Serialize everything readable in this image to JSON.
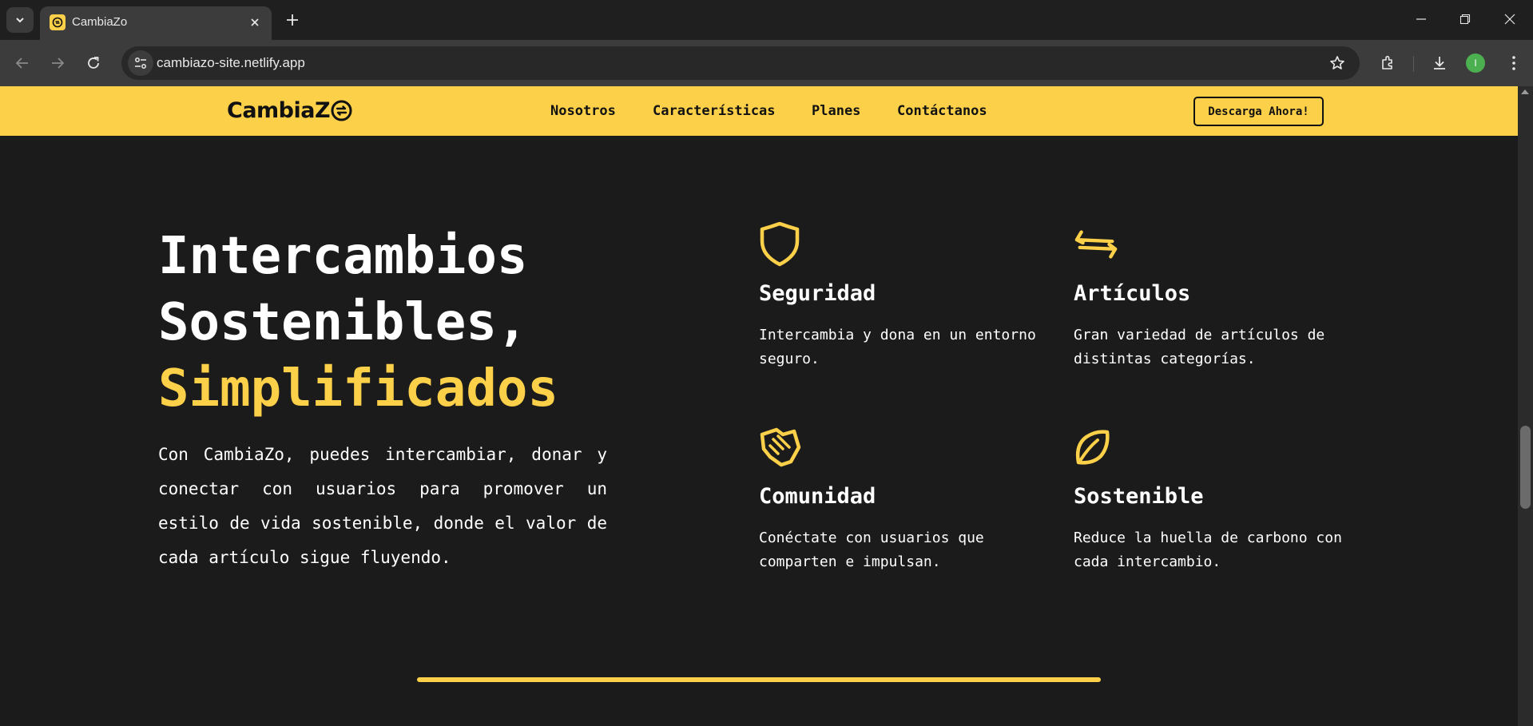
{
  "browser": {
    "tab_title": "CambiaZo",
    "url": "cambiazo-site.netlify.app",
    "profile_initial": "I",
    "icons": [
      "tab-search-icon",
      "close-icon",
      "plus-icon",
      "minimize-icon",
      "restore-icon",
      "close-window-icon",
      "back-icon",
      "forward-icon",
      "reload-icon",
      "site-info-icon",
      "star-icon",
      "extensions-icon",
      "download-icon",
      "menu-icon"
    ]
  },
  "site": {
    "logo_text": "CambiaZ",
    "nav": {
      "links": [
        "Nosotros",
        "Características",
        "Planes",
        "Contáctanos"
      ],
      "cta": "Descarga Ahora!"
    },
    "hero": {
      "title_line1": "Intercambios",
      "title_line2": "Sostenibles,",
      "title_accent": "Simplificados",
      "description": "Con CambiaZo, puedes intercambiar, donar y conectar con usuarios para promover un estilo de vida sostenible, donde el valor de cada artículo sigue fluyendo."
    },
    "features": [
      {
        "icon": "shield-icon",
        "title": "Seguridad",
        "text": "Intercambia y dona en un entorno seguro."
      },
      {
        "icon": "arrows-exchange-icon",
        "title": "Artículos",
        "text": "Gran variedad de artículos de distintas categorías."
      },
      {
        "icon": "handshake-icon",
        "title": "Comunidad",
        "text": "Conéctate con usuarios que comparten e impulsan."
      },
      {
        "icon": "leaf-icon",
        "title": "Sostenible",
        "text": "Reduce la huella de carbono con cada intercambio."
      }
    ]
  },
  "colors": {
    "accent": "#fdd049",
    "page_background": "#1b1b1b",
    "text": "#ffffff"
  }
}
